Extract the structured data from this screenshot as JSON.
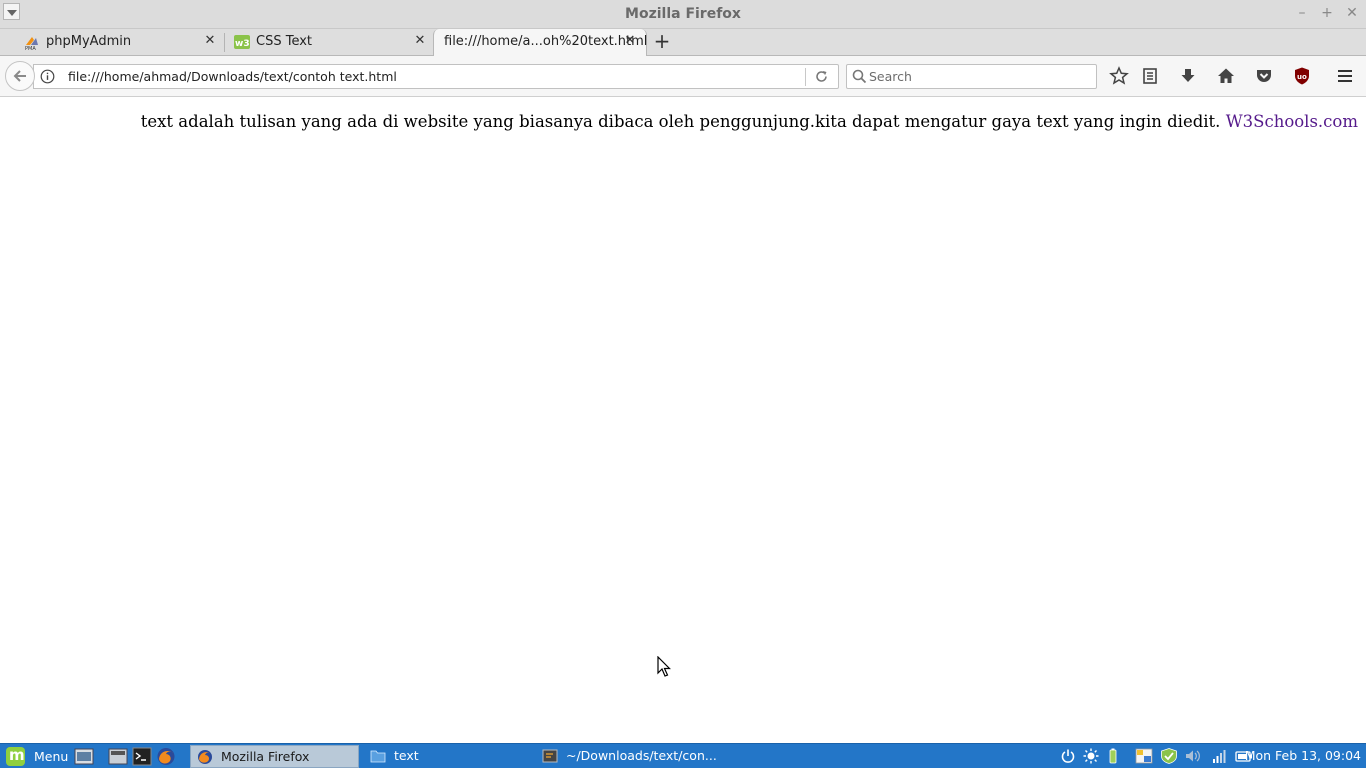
{
  "window": {
    "title": "Mozilla Firefox"
  },
  "tabs": [
    {
      "label": "phpMyAdmin",
      "favicon": "phpmyadmin-icon"
    },
    {
      "label": "CSS Text",
      "favicon": "w3schools-icon"
    },
    {
      "label": "file:///home/a...oh%20text.html",
      "favicon": "none"
    }
  ],
  "address_bar": {
    "url": "file:///home/ahmad/Downloads/text/contoh text.html"
  },
  "search": {
    "placeholder": "Search"
  },
  "page": {
    "paragraph": "text adalah tulisan yang ada di website yang biasanya dibaca oleh penggunjung.kita dapat mengatur gaya text yang ingin diedit.",
    "link_text": "W3Schools.com",
    "link_color": "#551a8b"
  },
  "taskbar": {
    "menu_label": "Menu",
    "windows": [
      {
        "label": "Mozilla Firefox",
        "icon": "firefox-icon",
        "active": true
      },
      {
        "label": "text",
        "icon": "folder-icon",
        "active": false
      },
      {
        "label": "~/Downloads/text/con...",
        "icon": "text-editor-icon",
        "active": false
      }
    ],
    "clock": "Mon Feb 13, 09:04",
    "accent": "#2376c8"
  }
}
